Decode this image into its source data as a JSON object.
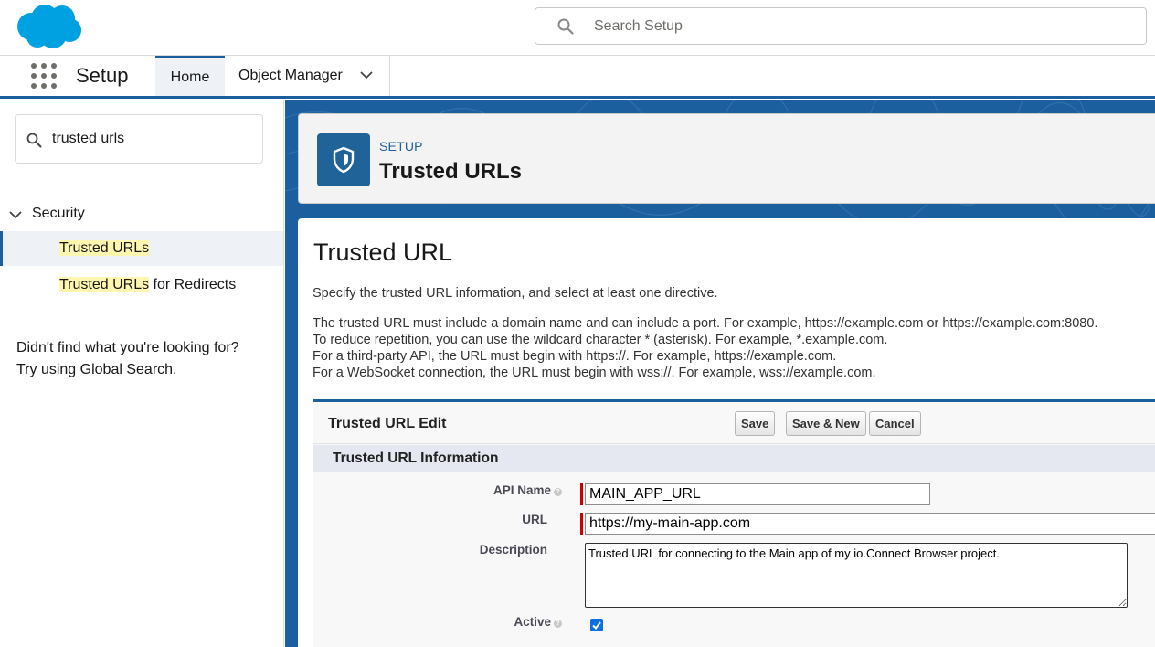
{
  "colors": {
    "brand_blue": "#1b5f9e",
    "salesforce_cloud": "#00a1e0",
    "required": "#cc0000",
    "highlight": "#fff7b0"
  },
  "global_header": {
    "logo": "salesforce-cloud-logo",
    "search": {
      "placeholder": "Search Setup",
      "value": ""
    }
  },
  "context_bar": {
    "app_name": "Setup",
    "tabs": [
      {
        "label": "Home",
        "active": true
      },
      {
        "label": "Object Manager",
        "has_dropdown": true
      }
    ]
  },
  "sidebar": {
    "quick_find": {
      "value": "trusted urls"
    },
    "tree": {
      "section": "Security",
      "expanded": true,
      "items": [
        {
          "highlight": "Trusted URLs",
          "rest": "",
          "selected": true
        },
        {
          "highlight": "Trusted URLs",
          "rest": " for Redirects",
          "selected": false
        }
      ]
    },
    "help": {
      "line1": "Didn't find what you're looking for?",
      "line2": "Try using Global Search."
    }
  },
  "page_header": {
    "eyebrow": "SETUP",
    "title": "Trusted URLs",
    "icon": "shield-icon"
  },
  "content": {
    "title": "Trusted URL",
    "intro": "Specify the trusted URL information, and select at least one directive.",
    "rules": [
      "The trusted URL must include a domain name and can include a port. For example, https://example.com or https://example.com:8080.",
      "To reduce repetition, you can use the wildcard character * (asterisk). For example, *.example.com.",
      "For a third-party API, the URL must begin with https://. For example, https://example.com.",
      "For a WebSocket connection, the URL must begin with wss://. For example, wss://example.com."
    ],
    "edit_block": {
      "title": "Trusted URL Edit",
      "buttons": {
        "save": "Save",
        "save_new": "Save & New",
        "cancel": "Cancel"
      },
      "section": "Trusted URL Information",
      "fields": {
        "api_name": {
          "label": "API Name",
          "value": "MAIN_APP_URL",
          "required": true
        },
        "url": {
          "label": "URL",
          "value": "https://my-main-app.com",
          "required": true
        },
        "description": {
          "label": "Description",
          "value": "Trusted URL for connecting to the Main app of my io.Connect Browser project."
        },
        "active": {
          "label": "Active",
          "checked": true
        }
      }
    }
  }
}
